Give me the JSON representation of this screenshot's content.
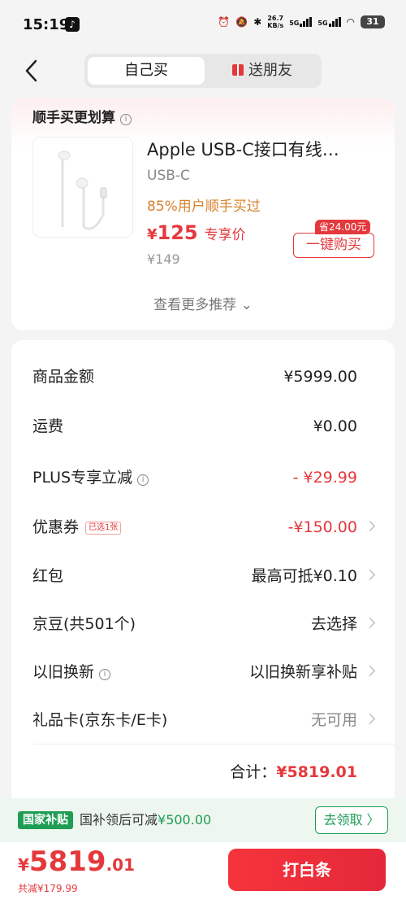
{
  "status_bar": {
    "time": "15:19",
    "net_speed": "26.7",
    "net_unit": "KB/s",
    "sig1": "5G",
    "sig2": "5G",
    "battery": "31"
  },
  "header": {
    "tab_self": "自己买",
    "tab_gift": "送朋友"
  },
  "recommend": {
    "title": "顺手买更划算",
    "product_name": "Apple USB-C接口有线…",
    "spec": "USB-C",
    "users_text": "85%用户顺手买过",
    "price_symbol": "¥",
    "price": "125",
    "price_tag": "专享价",
    "original_price": "¥149",
    "save_badge": "省24.00元",
    "buy_button": "一键购买",
    "more": "查看更多推荐"
  },
  "summary": {
    "goods_label": "商品金额",
    "goods_value": "¥5999.00",
    "shipping_label": "运费",
    "shipping_value": "¥0.00",
    "plus_label": "PLUS专享立减",
    "plus_value": "- ¥29.99",
    "coupon_label": "优惠券",
    "coupon_tag": "已选1张",
    "coupon_value": "-¥150.00",
    "redpacket_label": "红包",
    "redpacket_value": "最高可抵¥0.10",
    "jingdou_label": "京豆(共501个)",
    "jingdou_value": "去选择",
    "tradein_label": "以旧换新",
    "tradein_value": "以旧换新享补贴",
    "giftcard_label": "礼品卡(京东卡/E卡)",
    "giftcard_value": "无可用",
    "total_label": "合计：",
    "total_value": "¥5819.01"
  },
  "subsidy": {
    "badge": "国家补贴",
    "text": "国补领后可减",
    "amount": "¥500.00",
    "button": "去领取 〉"
  },
  "bottom": {
    "symbol": "¥",
    "int": "5819",
    "dec": ".01",
    "saved": "共减¥179.99",
    "pay_button": "打白条"
  },
  "colors": {
    "accent_red": "#e4393c",
    "subsidy_green": "#1f9d55",
    "orange": "#d9822b"
  }
}
